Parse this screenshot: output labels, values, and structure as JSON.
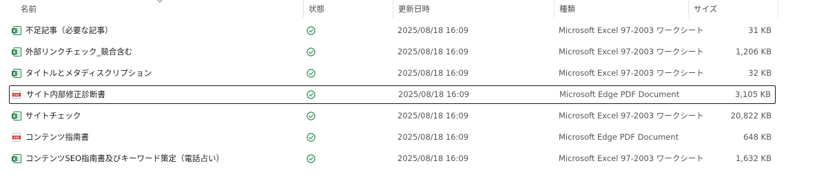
{
  "header": {
    "name": "名前",
    "status": "状態",
    "date": "更新日時",
    "type": "種類",
    "size": "サイズ"
  },
  "colors": {
    "excel_green": "#1d7a44",
    "pdf_red": "#d9342b",
    "status_green": "#2e8b57",
    "selection_border": "#1a1a1a"
  },
  "files": [
    {
      "name": "不足記事（必要な記事）",
      "date": "2025/08/18 16:09",
      "type": "Microsoft Excel 97-2003 ワークシート",
      "size": "31 KB",
      "icon": "excel-file-icon"
    },
    {
      "name": "外部リンクチェック_競合含む",
      "date": "2025/08/18 16:09",
      "type": "Microsoft Excel 97-2003 ワークシート",
      "size": "1,206 KB",
      "icon": "excel-file-icon"
    },
    {
      "name": "タイトルとメタディスクリプション",
      "date": "2025/08/18 16:09",
      "type": "Microsoft Excel 97-2003 ワークシート",
      "size": "32 KB",
      "icon": "excel-file-icon"
    },
    {
      "name": "サイト内部修正診断書",
      "date": "2025/08/18 16:09",
      "type": "Microsoft Edge PDF Document",
      "size": "3,105 KB",
      "icon": "pdf-file-icon",
      "selected": true
    },
    {
      "name": "サイトチェック",
      "date": "2025/08/18 16:09",
      "type": "Microsoft Excel 97-2003 ワークシート",
      "size": "20,822 KB",
      "icon": "excel-file-icon"
    },
    {
      "name": "コンテンツ指南書",
      "date": "2025/08/18 16:09",
      "type": "Microsoft Edge PDF Document",
      "size": "648 KB",
      "icon": "pdf-file-icon"
    },
    {
      "name": "コンテンツSEO指南書及びキーワード策定（電話占い）",
      "date": "2025/08/18 16:09",
      "type": "Microsoft Excel 97-2003 ワークシート",
      "size": "1,632 KB",
      "icon": "excel-file-icon"
    }
  ]
}
